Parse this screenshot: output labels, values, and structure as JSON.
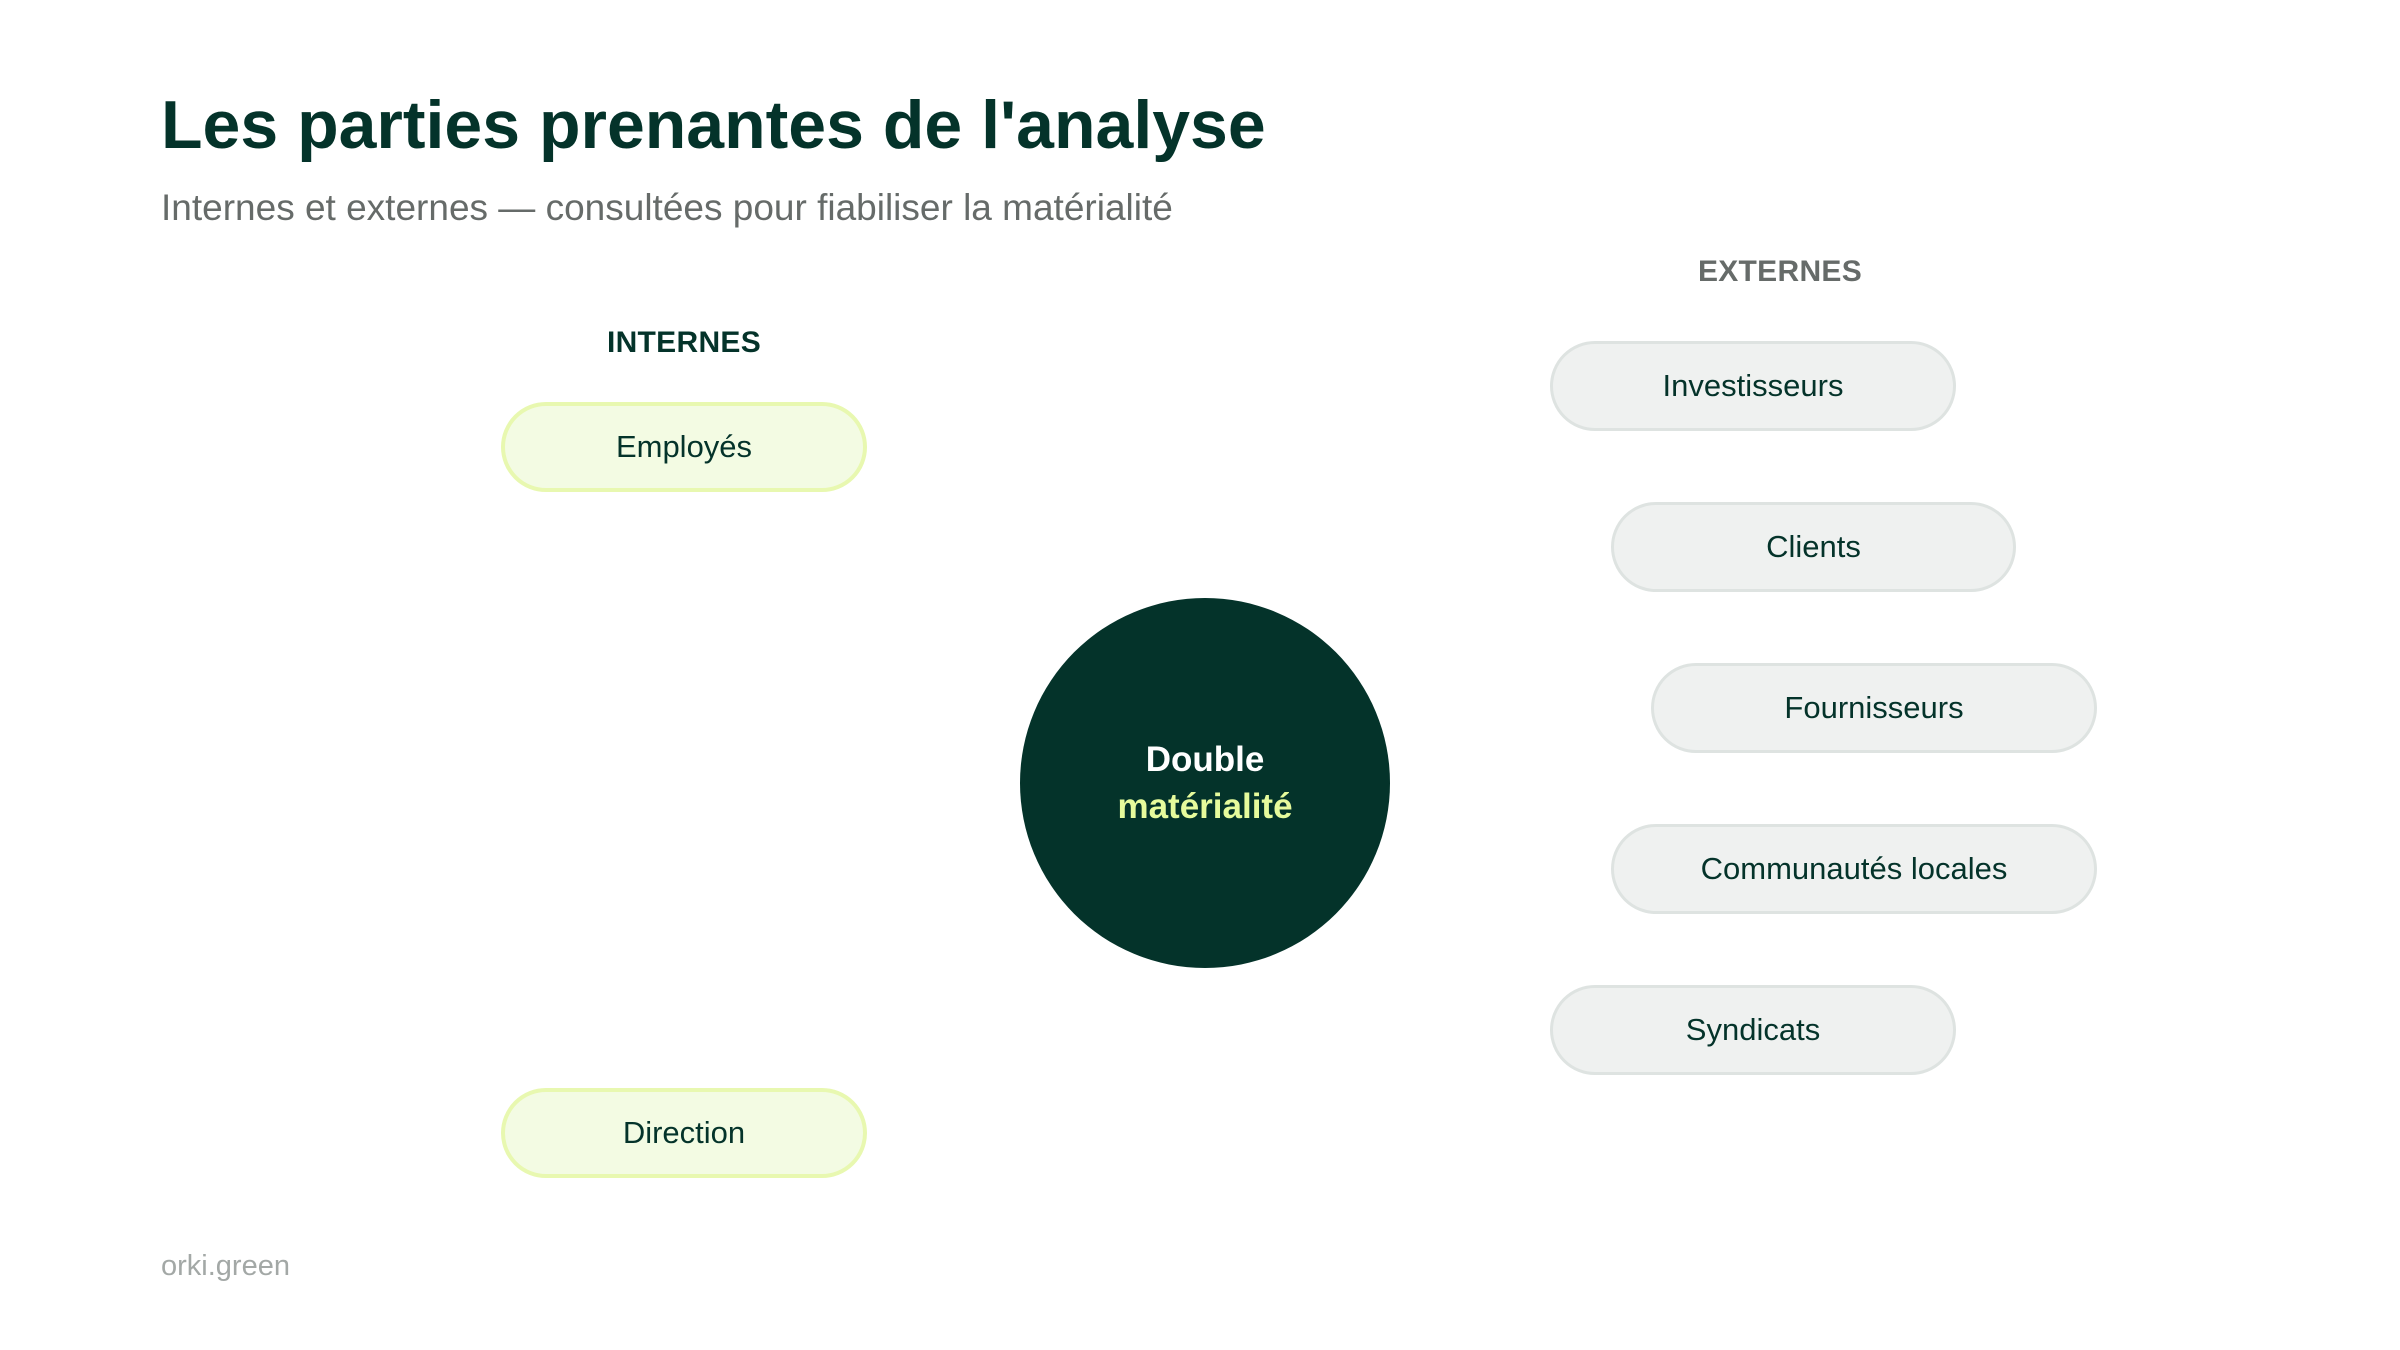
{
  "slide": {
    "title": "Les parties prenantes de l'analyse",
    "subtitle": "Internes et externes — consultées pour fiabiliser la matérialité",
    "footer": "orki.green"
  },
  "diagram": {
    "center": {
      "line1": "Double",
      "line2": "matérialité"
    },
    "internal": {
      "label": "INTERNES",
      "items": [
        "Employés",
        "Direction"
      ]
    },
    "external": {
      "label": "EXTERNES",
      "items": [
        "Investisseurs",
        "Clients",
        "Fournisseurs",
        "Communautés locales",
        "Syndicats"
      ]
    }
  },
  "colors": {
    "primary": "#04332a",
    "accent": "#e6fb9c",
    "internal_fill": "#f3fbe3",
    "internal_border": "#e8f8b0",
    "external_fill": "#eff1f0",
    "external_border": "#dee3e1",
    "muted_text": "#666b69"
  }
}
